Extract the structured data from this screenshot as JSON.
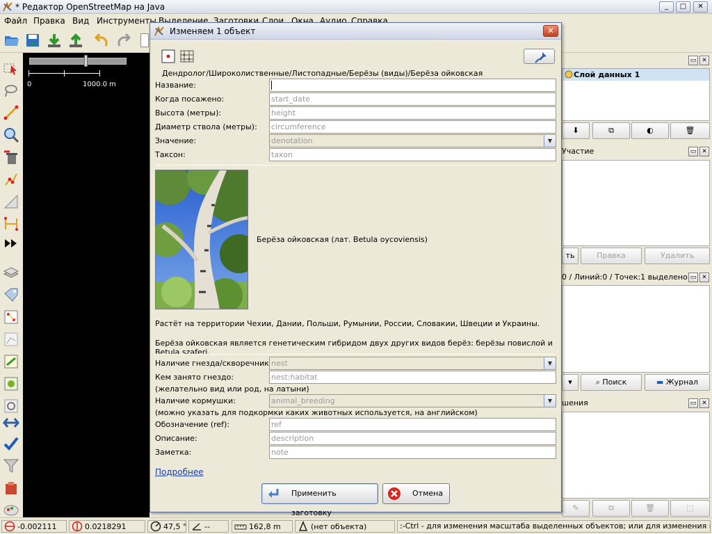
{
  "window": {
    "title": "* Редактор OpenStreetMap на Java",
    "minimize": "_",
    "maximize": "□",
    "close": "✕"
  },
  "menu": [
    "Файл",
    "Правка",
    "Вид",
    "Инструменты",
    "Выделение",
    "Заготовки",
    "Слои",
    "Окна",
    "Аудио",
    "Справка"
  ],
  "map": {
    "scale_start": "0",
    "scale_end": "1000.0 m"
  },
  "panels": {
    "layers": {
      "layer_name": "Слой данных 1"
    },
    "membership": {
      "title": "Участие",
      "edit_partial": "ть",
      "edit_button": "Правка",
      "delete_button": "Удалить"
    },
    "selection": {
      "title": "0 / Линий:0 / Точек:1 выделено",
      "search_button": "Поиск",
      "journal_button": "Журнал"
    },
    "relations": {
      "title": "шения"
    }
  },
  "statusbar": {
    "lat": "-0.002111",
    "lon": "0.0218291",
    "heading": "47,5 °",
    "angle": "--",
    "distance": "162,8 m",
    "object": "(нет объекта)",
    "hint": ":-Ctrl - для изменения масштаба выделенных объектов; или для изменения выделения"
  },
  "dialog": {
    "title": "Изменяем 1 объект",
    "close": "✕",
    "preset_path": "Дендролог/Широколиственные/Листопадные/Берёзы (виды)/Берёза ойковская",
    "fields": [
      {
        "label": "Название:",
        "value": "",
        "placeholder": ""
      },
      {
        "label": "Когда посажено:",
        "value": "start_date"
      },
      {
        "label": "Высота (метры):",
        "value": "height"
      },
      {
        "label": "Диаметр ствола (метры):",
        "value": "circumference"
      },
      {
        "label": "Значение:",
        "value": "denotation"
      },
      {
        "label": "Таксон:",
        "value": "taxon"
      }
    ],
    "photo_caption": "Берёза ойковская (лат. Betula oycoviensis)",
    "desc1": "Растёт на территории Чехии, Дании, Польши, Румынии, России, Словакии, Швеции и Украины.",
    "desc2": "Берёза ойковская является генетическим гибридом двух других видов берёз: берёзы повислой и Betula szaferi.",
    "fields2": [
      {
        "label": "Наличие гнезда/скворечника:",
        "value": "nest"
      },
      {
        "label": "Кем занято гнездо:",
        "value": "nest:habitat"
      },
      {
        "label": "Наличие кормушки:",
        "value": "animal_breeding"
      },
      {
        "label": "Обозначение (ref):",
        "value": "ref"
      },
      {
        "label": "Описание:",
        "value": "description"
      },
      {
        "label": "Заметка:",
        "value": "note"
      }
    ],
    "hint_nest": "(желательно вид или род, на латыни)",
    "hint_feeder": "(можно указать для подкормки каких животных используется, на английском)",
    "more_link": "Подробнее",
    "apply_button": "Применить заготовку",
    "cancel_button": "Отмена"
  },
  "colors": {
    "accent": "#1a3ea8",
    "map_bg": "#000000",
    "selected_layer_bg": "#cfe3f4"
  }
}
